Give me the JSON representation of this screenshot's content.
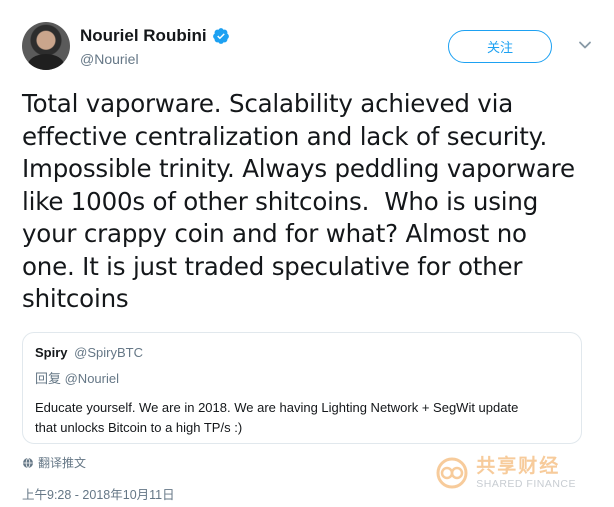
{
  "author": {
    "display_name": "Nouriel Roubini",
    "handle": "@Nouriel",
    "verified_icon": "verified-badge-icon"
  },
  "actions": {
    "follow_label": "关注",
    "more_icon": "chevron-down-icon"
  },
  "tweet": {
    "text": "Total vaporware. Scalability achieved via\neffective centralization and lack of security.\nImpossible trinity. Always peddling vaporware\nlike 1000s of other shitcoins.  Who is using\nyour crappy coin and for what? Almost no\none. It is just traded speculative for other\nshitcoins"
  },
  "quoted_tweet": {
    "display_name": "Spiry",
    "handle": "@SpiryBTC",
    "reply_to": "回复 @Nouriel",
    "text": "Educate yourself. We are in 2018. We are having Lighting Network + SegWit update\nthat unlocks Bitcoin to a high TP/s :)"
  },
  "footer": {
    "translate_label": "翻译推文",
    "timestamp": "上午9:28 - 2018年10月11日"
  },
  "watermark": {
    "text_cn": "共享财经",
    "text_en": "SHARED FINANCE"
  },
  "colors": {
    "accent": "#1da1f2",
    "secondary_text": "#657786",
    "border": "#e1e8ed",
    "watermark": "#f1a24a"
  }
}
